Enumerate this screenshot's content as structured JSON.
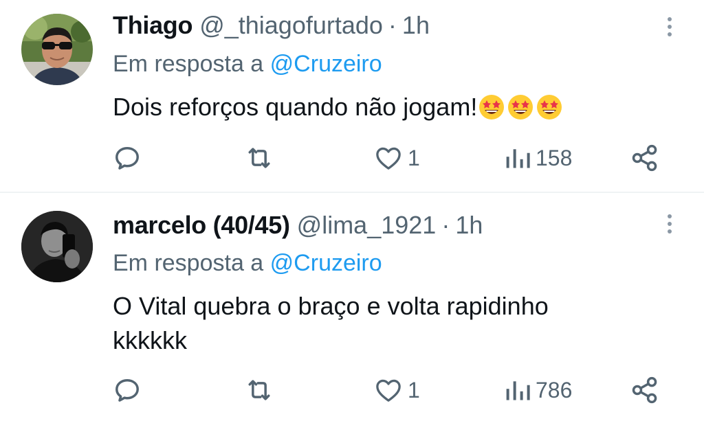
{
  "tweets": [
    {
      "display_name": "Thiago",
      "handle": "@_thiagofurtado",
      "separator": "·",
      "time": "1h",
      "reply_prefix": "Em resposta a",
      "reply_mention": "@Cruzeiro",
      "text_lines": [
        "Dois reforços quando não jogam!"
      ],
      "emojis": [
        "star-struck-emoji",
        "star-struck-emoji",
        "star-struck-emoji"
      ],
      "reply_count": "",
      "retweet_count": "",
      "like_count": "1",
      "view_count": "158"
    },
    {
      "display_name": "marcelo (40/45)",
      "handle": "@lima_1921",
      "separator": "·",
      "time": "1h",
      "reply_prefix": "Em resposta a",
      "reply_mention": "@Cruzeiro",
      "text_lines": [
        "O Vital quebra o braço e volta rapidinho",
        "kkkkkk"
      ],
      "emojis": [],
      "reply_count": "",
      "retweet_count": "",
      "like_count": "1",
      "view_count": "786"
    }
  ],
  "icons": {
    "reply": "speech-bubble-icon",
    "retweet": "retweet-arrows-icon",
    "like": "heart-outline-icon",
    "views": "bar-chart-icon",
    "share": "share-nodes-icon",
    "more": "vertical-ellipsis-icon"
  },
  "colors": {
    "text": "#0f1419",
    "secondary": "#536471",
    "mention": "#1d9bf0",
    "divider": "#eff3f4",
    "emoji_yellow": "#ffcc33"
  }
}
